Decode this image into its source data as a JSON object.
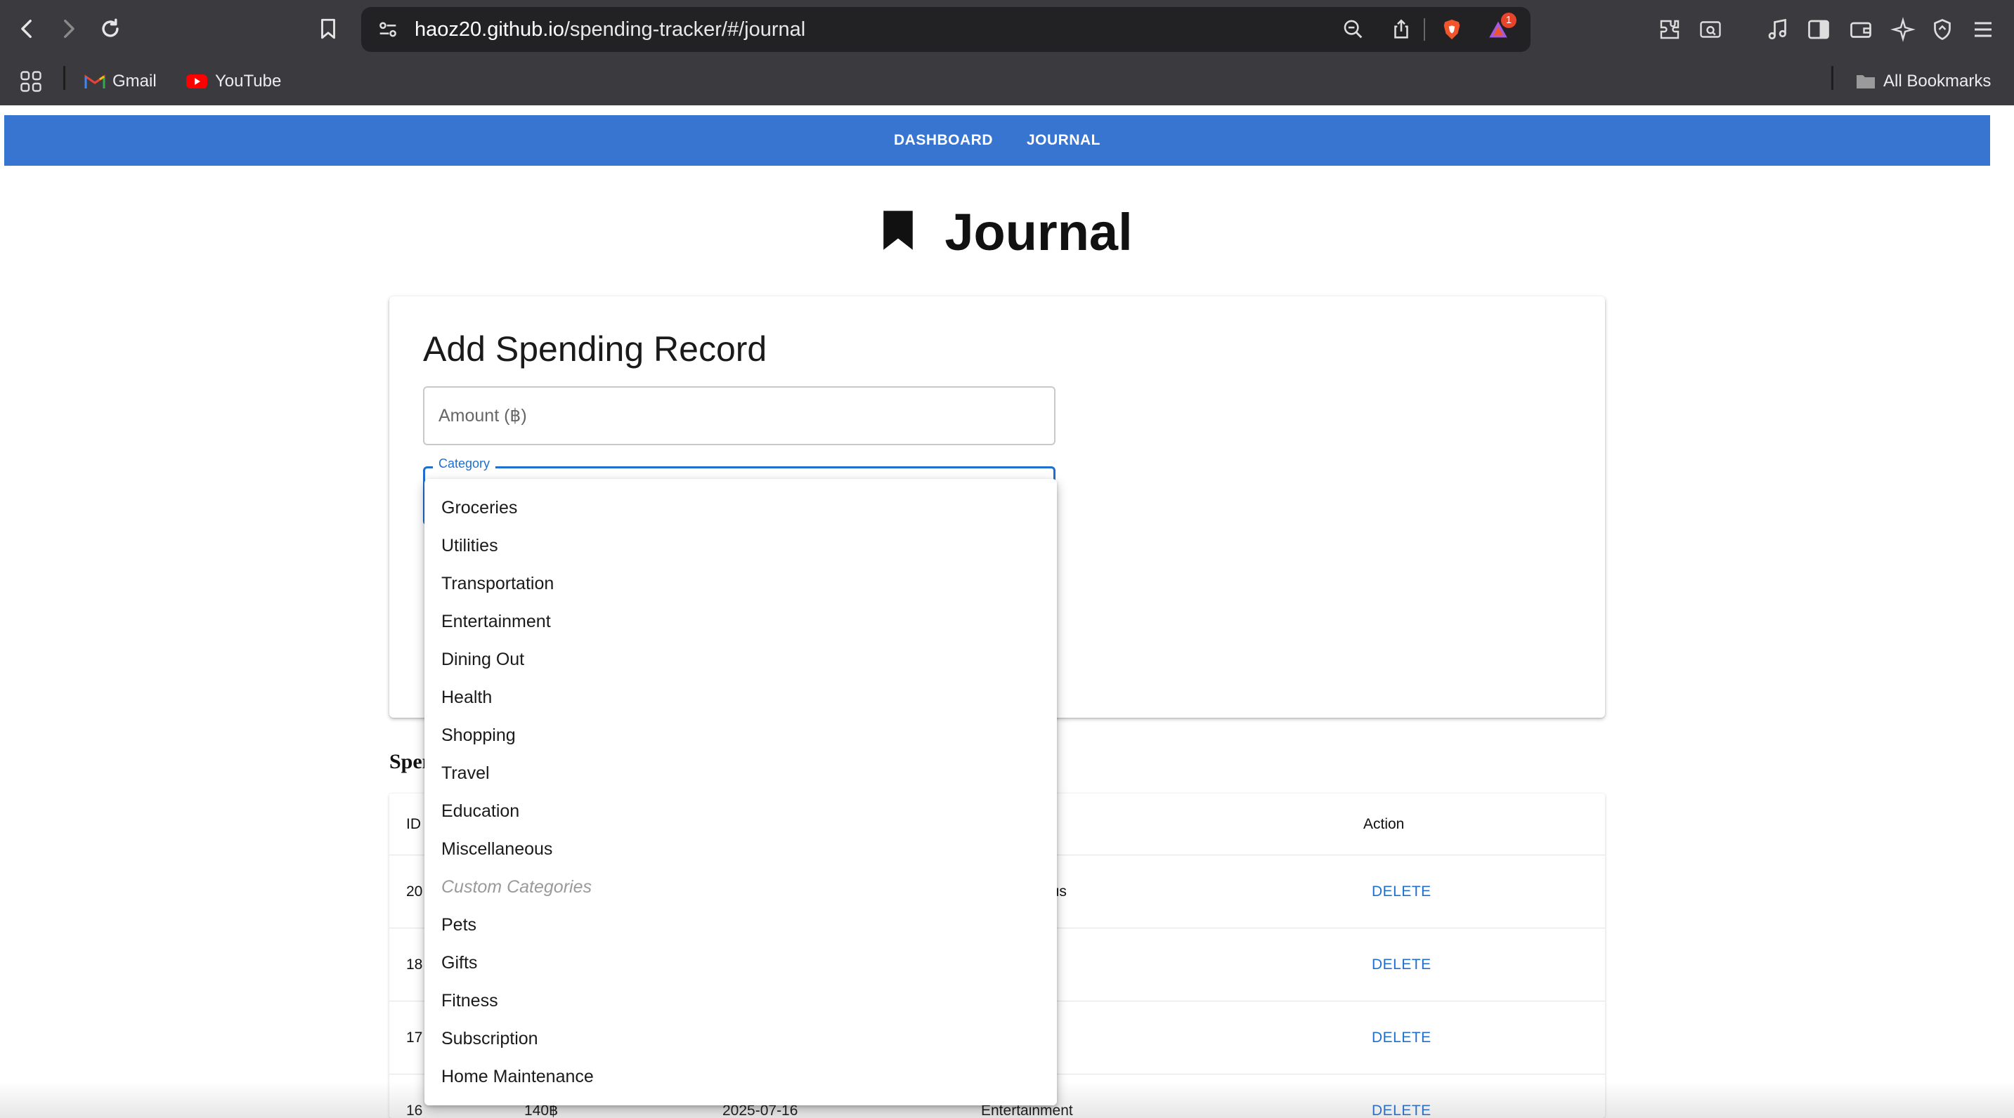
{
  "browser": {
    "url_host": "haoz20.github.io",
    "url_path": "/spending-tracker/#/journal",
    "notification_count": "1",
    "bookmarks": [
      {
        "label": "Gmail",
        "icon": "gmail-icon"
      },
      {
        "label": "YouTube",
        "icon": "youtube-icon"
      }
    ],
    "all_bookmarks_label": "All Bookmarks"
  },
  "appbar": {
    "links": [
      "DASHBOARD",
      "JOURNAL"
    ]
  },
  "page": {
    "title": "Journal",
    "title_icon": "bookmark-icon"
  },
  "form": {
    "heading": "Add Spending Record",
    "amount_placeholder": "Amount (฿)",
    "category_label": "Category"
  },
  "table": {
    "section_title": "Spen",
    "headers": {
      "id": "ID",
      "action": "Action"
    },
    "rows": [
      {
        "id": "20",
        "amount": "",
        "date": "",
        "category": "ous",
        "action": "DELETE"
      },
      {
        "id": "18",
        "amount": "",
        "date": "",
        "category": "",
        "action": "DELETE"
      },
      {
        "id": "17",
        "amount": "",
        "date": "",
        "category": "",
        "action": "DELETE"
      },
      {
        "id": "16",
        "amount": "140฿",
        "date": "2025-07-16",
        "category": "Entertainment",
        "action": "DELETE"
      }
    ]
  },
  "dropdown": {
    "options": [
      "Groceries",
      "Utilities",
      "Transportation",
      "Entertainment",
      "Dining Out",
      "Health",
      "Shopping",
      "Travel",
      "Education",
      "Miscellaneous"
    ],
    "custom_header": "Custom Categories",
    "custom_options": [
      "Pets",
      "Gifts",
      "Fitness",
      "Subscription",
      "Home Maintenance"
    ]
  },
  "colors": {
    "appbar": "#3875d1",
    "accent": "#1f6fd0",
    "chrome": "#3b3b3f"
  }
}
